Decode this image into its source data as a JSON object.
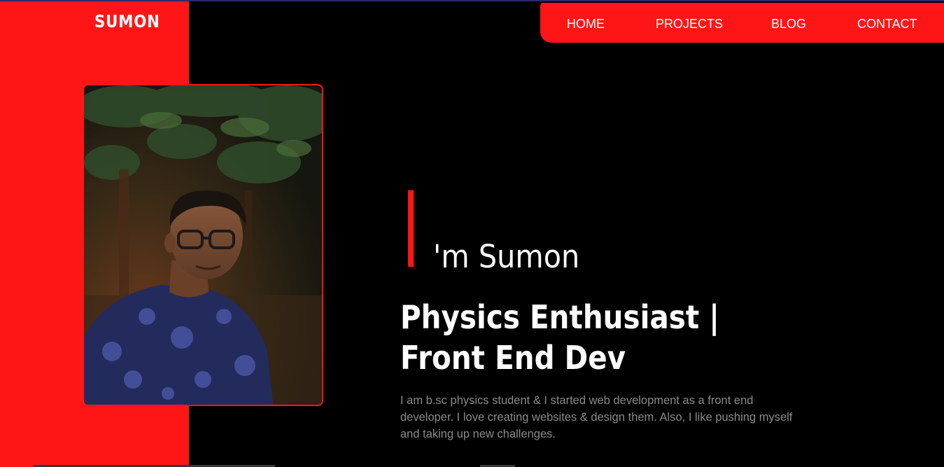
{
  "brand": {
    "logo": "SUMON",
    "accent_color": "#fe1616",
    "background_color": "#000000"
  },
  "nav": {
    "items": [
      {
        "label": "HOME"
      },
      {
        "label": "PROJECTS"
      },
      {
        "label": "BLOG"
      },
      {
        "label": "CONTACT"
      }
    ]
  },
  "hero": {
    "photo": "portrait-photo",
    "big_letter": "I",
    "name_rest": "'m Sumon",
    "title": "Physics Enthusiast | Front End Dev",
    "description": "I am b.sc physics student & I started web development as a front end developer. I love creating websites & design them. Also, I like pushing myself and taking up new challenges."
  }
}
